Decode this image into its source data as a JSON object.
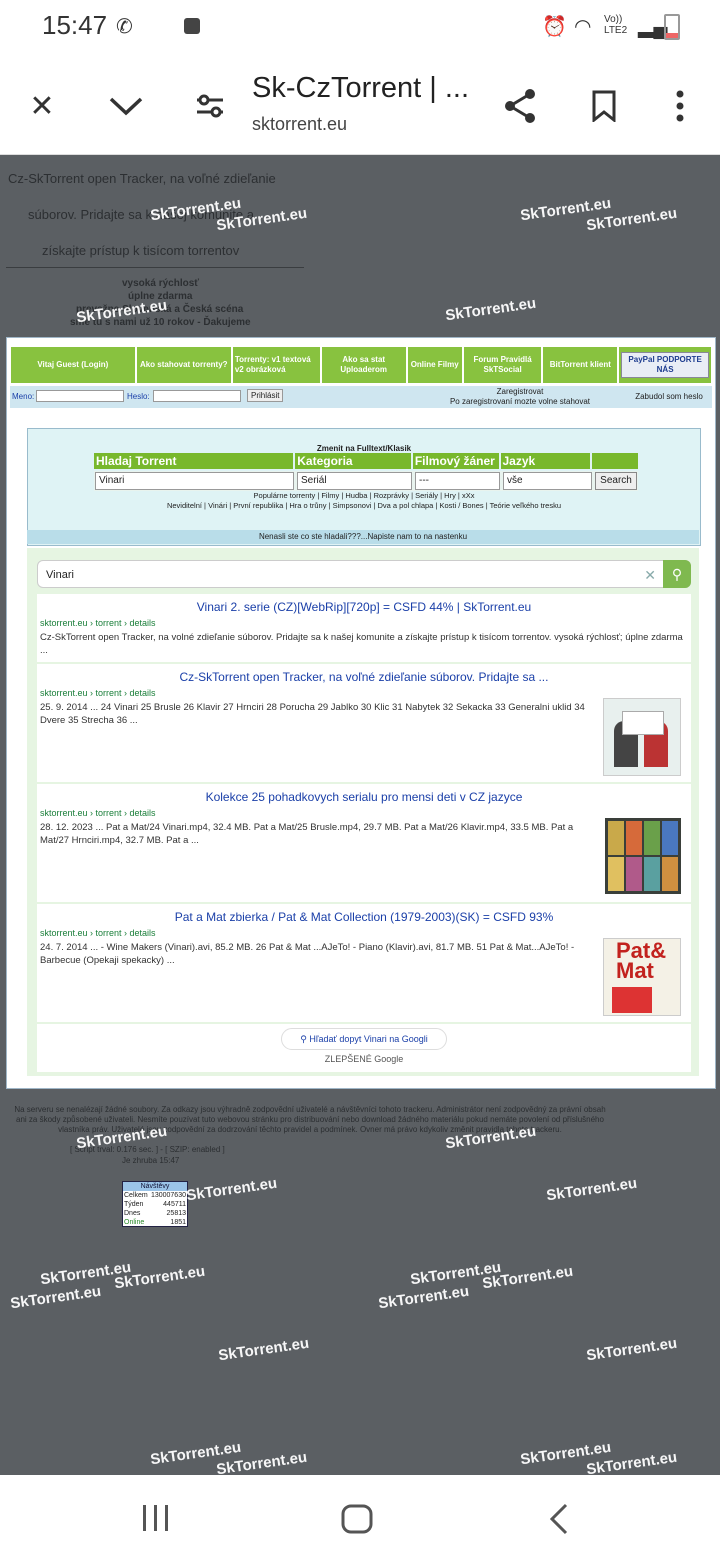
{
  "status_bar": {
    "time": "15:47",
    "network": "Vo)) LTE2"
  },
  "browser": {
    "title": "Sk-CzTorrent | ...",
    "url": "sktorrent.eu"
  },
  "watermark": "SkTorrent.eu",
  "header_text": {
    "line1": "Cz-SkTorrent open Tracker, na voľné zdieľanie",
    "line2": "súborov. Pridajte sa k našej komunite a",
    "line3": "získajte prístup k tisícom torrentov",
    "bullets": [
      "vysoká rýchlosť",
      "úplne zdarma",
      "prevažne Slovenská a Česká scéna",
      "sme tu s nami už 10 rokov - Ďakujeme"
    ]
  },
  "nav": {
    "welcome": "Vitaj Guest (Login)",
    "items": [
      "Ako stahovat torrenty?",
      "Torrenty: v1 textová v2 obrázková",
      "Ako sa stat Uploaderom",
      "Online Filmy",
      "Forum Pravidlá SkTSocial",
      "BitTorrent klient",
      "PayPal PODPORTE NÁS"
    ]
  },
  "login": {
    "meno": "Meno:",
    "heslo": "Heslo:",
    "submit": "Prihlásit",
    "register": "Zaregistrovat",
    "register_note": "Po zaregistrovaní mozte volne stahovat",
    "forgot": "Zabudol som heslo"
  },
  "search": {
    "switch": "Zmenit na Fulltext/Klasik",
    "headers": [
      "Hladaj Torrent",
      "Kategoria",
      "Filmový žáner",
      "Jazyk"
    ],
    "query": "Vinari",
    "category": "Seriál",
    "genre": "---",
    "lang": "vše",
    "button": "Search",
    "links1": "Populárne torrenty | Filmy | Hudba | Rozprávky | Seriály | Hry | xXx",
    "links2": "Neviditelní | Vinári | První republika | Hra o trůny | Simpsonovi | Dva a pol chlapa | Kosti / Bones | Teórie veľkého tresku",
    "notfound": "Nenasli ste co ste hladali???...Napiste nam to na nastenku"
  },
  "gsearch": {
    "query": "Vinari",
    "more": "Hľadať dopyt Vinari na Googli",
    "brand": "ZLEPŠENÉ Google"
  },
  "results": [
    {
      "title": "Vinari 2. serie (CZ)[WebRip][720p] = CSFD 44% | SkTorrent.eu",
      "crumb": "sktorrent.eu › torrent › details",
      "snippet": "Cz-SkTorrent open Tracker, na volné zdieľanie súborov. Pridajte sa k našej komunite a získajte prístup k tisícom torrentov. vysoká rýchlosť; úplne zdarma ..."
    },
    {
      "title": "Cz-SkTorrent open Tracker, na voľné zdieľanie súborov. Pridajte sa ...",
      "crumb": "sktorrent.eu › torrent › details",
      "snippet": "25. 9. 2014 ... 24 Vinari 25 Brusle 26 Klavir 27 Hrnciri 28 Porucha 29 Jablko 30 Klic 31 Nabytek 32 Sekacka 33 Generalni uklid 34 Dvere 35 Strecha 36 ..."
    },
    {
      "title": "Kolekce 25 pohadkovych serialu pro mensi deti v CZ jazyce",
      "crumb": "sktorrent.eu › torrent › details",
      "snippet": "28. 12. 2023 ... Pat a Mat/24 Vinari.mp4, 32.4 MB. Pat a Mat/25 Brusle.mp4, 29.7 MB. Pat a Mat/26 Klavir.mp4, 33.5 MB. Pat a Mat/27 Hrnciri.mp4, 32.7 MB. Pat a ..."
    },
    {
      "title": "Pat a Mat zbierka / Pat & Mat Collection (1979-2003)(SK) = CSFD 93%",
      "crumb": "sktorrent.eu › torrent › details",
      "snippet": "24. 7. 2014 ... - Wine Makers (Vinari).avi, 85.2 MB. 26 Pat & Mat ...AJeTo! - Piano (Klavir).avi, 81.7 MB. 51 Pat & Mat...AJeTo! - Barbecue (Opekaji spekacky) ..."
    }
  ],
  "footer": {
    "text": "Na serveru se nenalézají žádné soubory. Za odkazy jsou výhradně zodpovědní uživatelé a návštěvníci tohoto trackeru. Administrátor není zodpovědný za právní obsah ani za škody způsobené uživateli. Nesmíte pouzívat tuto webovou stránku pro distribuování nebo download žádného materiálu pokud nemáte povolení od příslušného vlastníka práv. Uživatelé jsou zodpovědní za dodrzování těchto pravidel a podmínek. Ovner má právo kdykoliv změnit pravidla tohoto trackeru.",
    "gen": "[ Script trval: 0.176 sec. ] - [ SZIP: enabled ]",
    "time": "Je zhruba 15:47",
    "stats_title": "Návštěvy",
    "stats": [
      [
        "Celkem",
        "130007630"
      ],
      [
        "Týden",
        "445711"
      ],
      [
        "Dnes",
        "25813"
      ],
      [
        "Online",
        "1851"
      ]
    ]
  }
}
